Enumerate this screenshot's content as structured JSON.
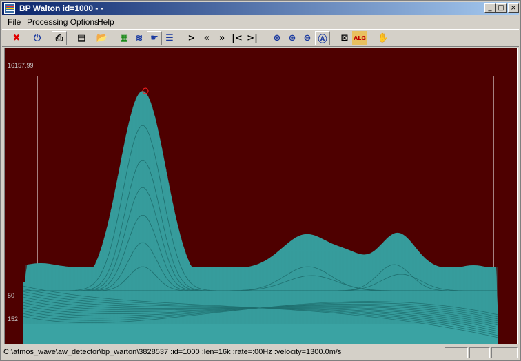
{
  "window": {
    "title": "BP Walton id=1000 - -",
    "minimize": "_",
    "maximize": "□",
    "close": "×"
  },
  "menu": [
    {
      "label": "File"
    },
    {
      "label": "Processing Options"
    },
    {
      "label": "Help"
    }
  ],
  "toolbar": [
    {
      "name": "close-x-icon",
      "glyph": "✖",
      "color": "#e00000"
    },
    {
      "name": "power-icon",
      "glyph": "⏻",
      "color": "#1a3aa0"
    },
    {
      "name": "print-preview-icon",
      "glyph": "⎙",
      "color": "#000000"
    },
    {
      "name": "notepad-icon",
      "glyph": "▤",
      "color": "#000000"
    },
    {
      "name": "open-folder-icon",
      "glyph": "📂",
      "color": "#c89000"
    },
    {
      "name": "chart-icon",
      "glyph": "▦",
      "color": "#008000"
    },
    {
      "name": "waveform-view-icon",
      "glyph": "≋",
      "color": "#1a3aa0"
    },
    {
      "name": "hand-blue-icon",
      "glyph": "☛",
      "color": "#1a3aa0"
    },
    {
      "name": "list-view-icon",
      "glyph": "☰",
      "color": "#1a3aa0"
    },
    {
      "name": "next-icon",
      "glyph": ">",
      "color": "#000000"
    },
    {
      "name": "fast-back-icon",
      "glyph": "«",
      "color": "#000000"
    },
    {
      "name": "fast-forward-icon",
      "glyph": "»",
      "color": "#000000"
    },
    {
      "name": "first-icon",
      "glyph": "|<",
      "color": "#000000"
    },
    {
      "name": "last-icon",
      "glyph": ">|",
      "color": "#000000"
    },
    {
      "name": "zoom-fit-icon",
      "glyph": "⊕",
      "color": "#1a3aa0"
    },
    {
      "name": "zoom-in-icon",
      "glyph": "⊕",
      "color": "#1a3aa0"
    },
    {
      "name": "zoom-out-icon",
      "glyph": "⊖",
      "color": "#1a3aa0"
    },
    {
      "name": "zoom-auto-icon",
      "glyph": "Ⓐ",
      "color": "#1a3aa0"
    },
    {
      "name": "fullscreen-icon",
      "glyph": "⊠",
      "color": "#000000"
    },
    {
      "name": "algorithm-icon",
      "glyph": "ALG",
      "color": "#c00000"
    },
    {
      "name": "hand-pan-icon",
      "glyph": "✋",
      "color": "#d4a000"
    }
  ],
  "plot": {
    "y_labels": {
      "top": "16157.99",
      "mid": "50",
      "low": "152"
    },
    "colors": {
      "background": "#4e0000",
      "trace": "#3aa3a3",
      "peak_marker": "#ff2020"
    }
  },
  "status": {
    "text": "C:\\atmos_wave\\aw_detector\\bp_warton\\3828537 :id=1000 :len=16k :rate=:00Hz :velocity=1300.0m/s"
  }
}
